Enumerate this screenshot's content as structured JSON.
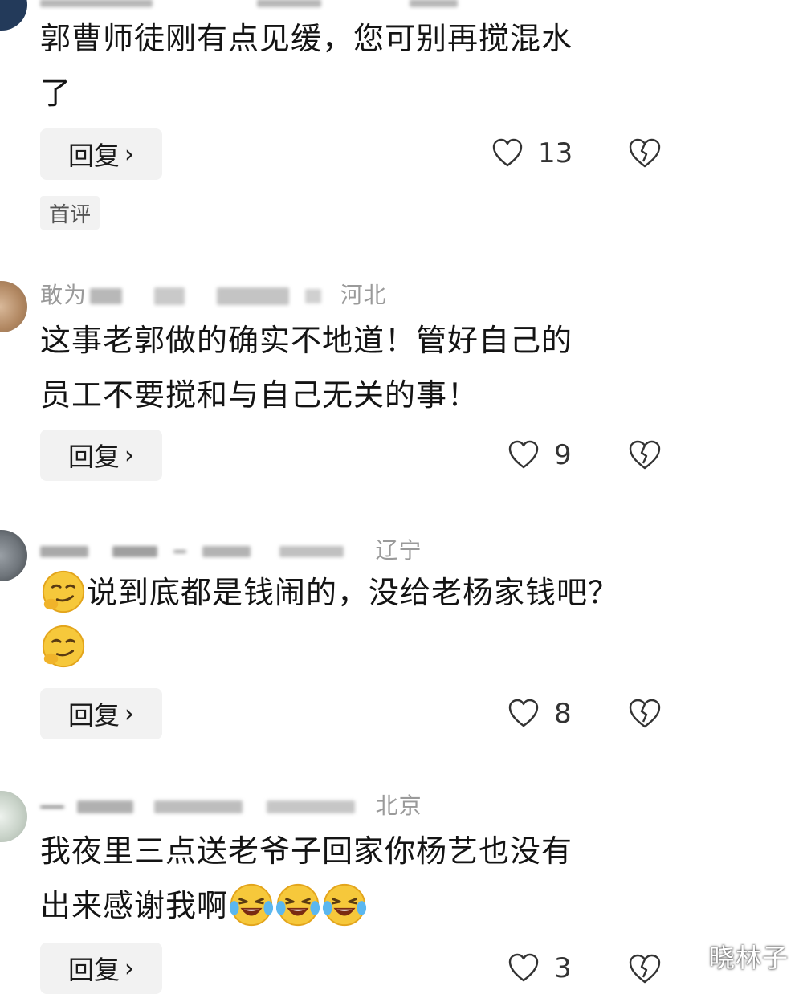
{
  "comments": [
    {
      "meta_visible": "",
      "text_line1": "郭曹师徒刚有点见缓，您可别再搅混水",
      "text_line2": "了",
      "reply_label": "回复",
      "likes": "13",
      "tag": "首评"
    },
    {
      "meta_name": "敢为",
      "meta_location": "河北",
      "text_line1": "这事老郭做的确实不地道！管好自己的",
      "text_line2": "员工不要搅和与自己无关的事！",
      "reply_label": "回复",
      "likes": "9"
    },
    {
      "meta_name": "",
      "meta_location": "辽宁",
      "text_line1": "说到底都是钱闹的，没给老杨家钱吧？",
      "reply_label": "回复",
      "likes": "8",
      "emoji_name": "smirk-emoji"
    },
    {
      "meta_name": "",
      "meta_location": "北京",
      "text_line1": "我夜里三点送老爷子回家你杨艺也没有",
      "text_line2": "出来感谢我啊",
      "reply_label": "回复",
      "likes": "3",
      "emoji_name": "laugh-cry-emoji"
    }
  ],
  "watermark": "晓林子",
  "colors": {
    "text": "#141414",
    "meta": "#9a9a9a",
    "button_bg": "#f2f2f2"
  },
  "icons": {
    "like": "heart-outline-icon",
    "dislike": "broken-heart-icon",
    "reply": "chevron-right-icon"
  }
}
